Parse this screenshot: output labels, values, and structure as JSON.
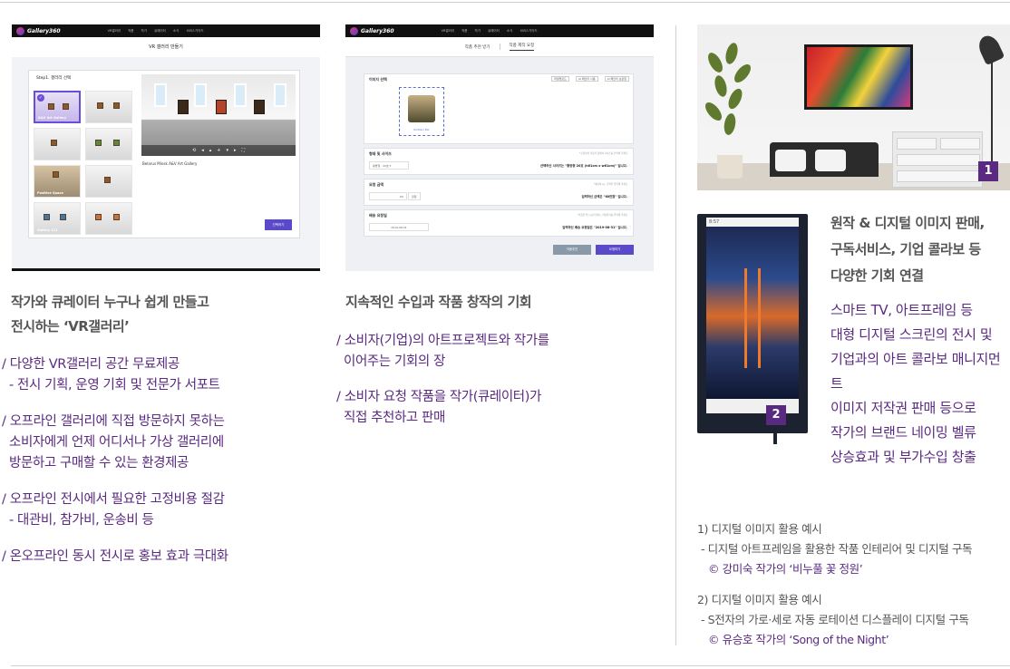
{
  "screenshot1": {
    "logo": "Gallery360",
    "menu": [
      "VR갤러리",
      "작품",
      "작가",
      "큐레이터",
      "소식",
      "서비스가이드"
    ],
    "page_title": "VR 갤러리 만들기",
    "step_label": "Step1. 갤러리 선택",
    "step_hint": "*원하는 갤러리 공간을 선택하여 주세요.",
    "thumbs": [
      "A&V Art Gallery",
      "Positive Space",
      "Gallery 111"
    ],
    "gallery_name": "Belarus Minsk A&V Art Gallery",
    "next_button": "선택하기"
  },
  "screenshot2": {
    "logo": "Gallery360",
    "menu": [
      "VR갤러리",
      "작품",
      "작가",
      "큐레이터",
      "소식",
      "서비스가이드"
    ],
    "tabs": [
      "작품 추천 받기",
      "작품 제작 요청"
    ],
    "image_section": "이미지 선택",
    "image_options": [
      "파일업로드",
      "AI 페인터 사용",
      "AI 페인터 보관함"
    ],
    "image_name": "Northern Pier",
    "size_section": "형태 및 사이즈",
    "size_hint": "*요청하실 작품의 형태와 사이즈를 선택해 주세요.",
    "size_select": "황방형 · 20호 ▾",
    "size_summary": "선택하신 사이즈는 \"황방형 20호 (h61cm x w61cm)\" 입니다.",
    "price_section": "요청 금액",
    "price_hint": "*예산하시는 금액을 입력해 주세요.",
    "price_value": "60",
    "price_unit": "만원",
    "price_summary": "입력하신 금액은 \"60만원\" 입니다.",
    "date_section": "배송 요청일",
    "date_hint": "*작품을 받으시길 원하는 희망일자를 입력해 주세요.",
    "date_value": "2019-08-31",
    "date_summary": "입력하신 배송 요청일은 \"2019-08-31\" 입니다.",
    "btn_recommend": "자동추천",
    "btn_request": "요청하기"
  },
  "col1": {
    "title": [
      "작가와 큐레이터 누구나 쉽게 만들고",
      "전시하는 ‘VR갤러리’"
    ],
    "items": [
      {
        "main": "/ 다양한 VR갤러리 공간 무료제공",
        "sub": [
          "- 전시 기획, 운영 기회 및 전문가 서포트"
        ]
      },
      {
        "main": "/ 오프라인 갤러리에 직접 방문하지 못하는",
        "sub": [
          "소비자에게 언제 어디서나 가상 갤러리에",
          "방문하고 구매할 수 있는 환경제공"
        ]
      },
      {
        "main": "/ 오프라인 전시에서 필요한 고정비용 절감",
        "sub": [
          "- 대관비, 참가비, 운송비 등"
        ]
      },
      {
        "main": "/ 온오프라인 동시 전시로 홍보 효과 극대화",
        "sub": []
      }
    ]
  },
  "col2": {
    "title": "지속적인 수입과 작품 창작의 기회",
    "items": [
      {
        "main": "/ 소비자(기업)의 아트프로젝트와 작가를",
        "sub": [
          "이어주는 기회의 장"
        ]
      },
      {
        "main": "/ 소비자 요청 작품을 작가(큐레이터)가",
        "sub": [
          "직접 추천하고 판매"
        ]
      }
    ]
  },
  "col3": {
    "badge1": "1",
    "badge2": "2",
    "kiosk_time": "8:57",
    "title": [
      "원작 & 디지털 이미지 판매,",
      "구독서비스, 기업 콜라보 등",
      "다양한 기회 연결"
    ],
    "text": [
      "스마트 TV, 아트프레임 등",
      "대형 디지털 스크린의 전시 및",
      "기업과의 아트 콜라보 매니지먼트",
      "이미지 저작권 판매 등으로",
      "작가의 브랜드 네이밍 벨류",
      "상승효과 및 부가수입 창출"
    ],
    "caption1": {
      "heading": "1) 디지털 이미지 활용 예시",
      "desc": "- 디지털 아트프레임을 활용한 작품 인테리어 및 디지털 구독",
      "credit": "© 강미숙 작가의 ‘비누풀 꽃 정원’"
    },
    "caption2": {
      "heading": "2) 디지털 이미지 활용 예시",
      "desc": "- S전자의 가로·세로 자동 로테이션 디스플레이 디지털 구독",
      "credit": "© 유승호 작가의 ‘Song of the Night’"
    }
  },
  "colors": {
    "accent": "#5a2a82",
    "button": "#5a49c9",
    "heading": "#555555"
  }
}
